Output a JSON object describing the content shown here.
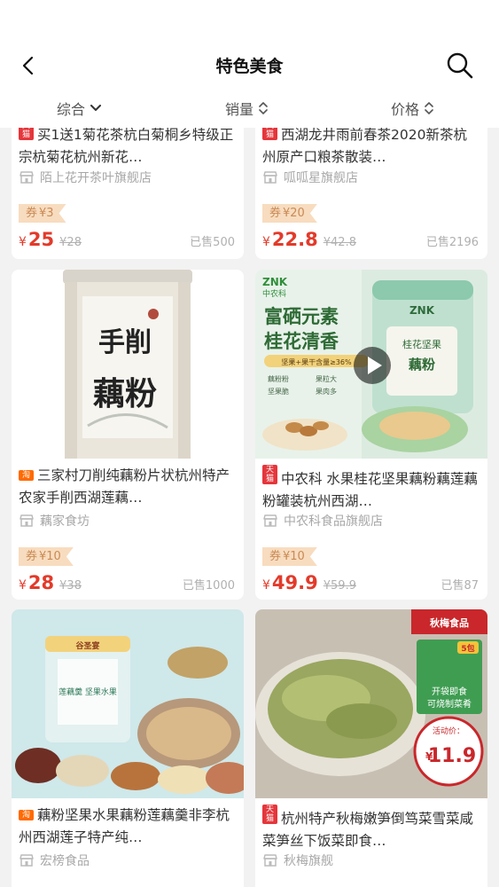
{
  "nav": {
    "title": "特色美食"
  },
  "filters": [
    {
      "label": "综合"
    },
    {
      "label": "销量"
    },
    {
      "label": "价格"
    }
  ],
  "products": [
    {
      "badge": "天猫",
      "title": "买1送1菊花茶杭白菊桐乡特级正宗杭菊花杭州新花…",
      "shop": "陌上花开茶叶旗舰店",
      "coupon_prefix": "券",
      "coupon": "¥3",
      "currency": "¥",
      "price": "25",
      "original_price": "¥28",
      "sold": "已售500"
    },
    {
      "badge": "天猫",
      "title": "西湖龙井雨前春茶2020新茶杭州原产口粮茶散装…",
      "shop": "呱呱星旗舰店",
      "coupon_prefix": "券",
      "coupon": "¥20",
      "currency": "¥",
      "price": "22.8",
      "original_price": "¥42.8",
      "sold": "已售2196"
    },
    {
      "badge": "淘",
      "title": "三家村刀削纯藕粉片状杭州特产农家手削西湖莲藕…",
      "shop": "藕家食坊",
      "coupon_prefix": "券",
      "coupon": "¥10",
      "currency": "¥",
      "price": "28",
      "original_price": "¥38",
      "sold": "已售1000",
      "image_text": {
        "line1": "手削",
        "line2": "藕粉"
      }
    },
    {
      "badge": "天猫",
      "title": "中农科 水果桂花坚果藕粉藕莲藕粉罐装杭州西湖…",
      "shop": "中农科食品旗舰店",
      "coupon_prefix": "券",
      "coupon": "¥10",
      "currency": "¥",
      "price": "49.9",
      "original_price": "¥59.9",
      "sold": "已售87",
      "image_text": {
        "brand": "ZNK",
        "brand_cn": "中农科",
        "line1": "富硒元素",
        "line2": "桂花清香",
        "tag": "坚果+果干含量≥36%",
        "items": [
          "藕粉粉",
          "果粒大",
          "坚果脆",
          "果肉多"
        ],
        "can_label": "桂花坚果",
        "can_label2": "藕粉"
      }
    },
    {
      "badge": "淘",
      "title": "藕粉坚果水果藕粉莲藕羹非李杭州西湖莲子特产纯…",
      "shop": "宏榜食品",
      "image_text": {
        "brand": "谷圣宴",
        "can_label": "莲藕羹 坚果水果"
      }
    },
    {
      "badge": "天猫",
      "title": "杭州特产秋梅嫩笋倒笃菜雪菜咸菜笋丝下饭菜即食…",
      "shop": "秋梅旗舰",
      "image_text": {
        "brand": "秋梅食品",
        "pack": "5包",
        "line1": "开袋即食",
        "line2": "可烧制菜肴",
        "promo_label": "活动价：",
        "promo_currency": "¥",
        "promo_price": "11.9"
      }
    }
  ]
}
